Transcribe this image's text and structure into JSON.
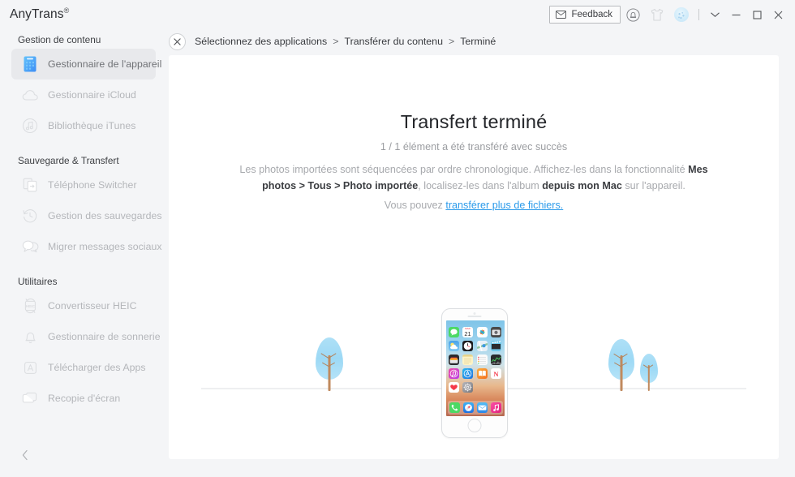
{
  "app": {
    "brand": "AnyTrans",
    "brand_mark": "®"
  },
  "titlebar": {
    "feedback_label": "Feedback",
    "feedback_icon": "envelope-icon",
    "notification_icon": "bell-icon",
    "skin_icon": "tshirt-icon",
    "avatar_icon": "user-avatar",
    "dropdown_icon": "chevron-down-icon",
    "minimize_icon": "minimize-icon",
    "maximize_icon": "maximize-icon",
    "close_icon": "close-icon"
  },
  "sidebar": {
    "sections": [
      {
        "title": "Gestion de contenu",
        "items": [
          {
            "label": "Gestionnaire de l'appareil",
            "icon": "device-icon",
            "active": true
          },
          {
            "label": "Gestionnaire iCloud",
            "icon": "cloud-icon",
            "active": false
          },
          {
            "label": "Bibliothèque iTunes",
            "icon": "itunes-note-icon",
            "active": false
          }
        ]
      },
      {
        "title": "Sauvegarde & Transfert",
        "items": [
          {
            "label": "Téléphone Switcher",
            "icon": "phone-switcher-icon",
            "active": false
          },
          {
            "label": "Gestion des sauvegardes",
            "icon": "backup-clock-icon",
            "active": false
          },
          {
            "label": "Migrer messages sociaux",
            "icon": "chat-bubbles-icon",
            "active": false
          }
        ]
      },
      {
        "title": "Utilitaires",
        "items": [
          {
            "label": "Convertisseur HEIC",
            "icon": "heic-convert-icon",
            "active": false
          },
          {
            "label": "Gestionnaire de sonnerie",
            "icon": "bell-ringtone-icon",
            "active": false
          },
          {
            "label": "Télécharger des Apps",
            "icon": "app-store-icon",
            "active": false
          },
          {
            "label": "Recopie d'écran",
            "icon": "screen-mirror-icon",
            "active": false
          }
        ]
      }
    ],
    "collapse_icon": "chevron-left-icon"
  },
  "breadcrumb": {
    "close_icon": "close-icon",
    "separator": ">",
    "crumbs": [
      "Sélectionnez des applications",
      "Transférer du contenu",
      "Terminé"
    ]
  },
  "main": {
    "title": "Transfert terminé",
    "subtitle": "1 / 1 élément a été transféré avec succès",
    "description": {
      "part1": "Les photos importées sont séquencées par ordre chronologique. Affichez-les dans la fonctionnalité ",
      "bold1": "Mes photos > Tous > Photo importée",
      "part2": ", localisez-les dans l'album ",
      "bold2": "depuis mon Mac",
      "part3": " sur l'appareil."
    },
    "more": {
      "prefix": "Vous pouvez ",
      "link": "transférer plus de fichiers."
    },
    "illustration": {
      "device_icon": "iphone-illustration",
      "tree_left_icon": "tree-icon",
      "tree_right_large_icon": "tree-icon",
      "tree_right_small_icon": "tree-icon",
      "ground_icon": "ground-line"
    }
  },
  "phone_screen": {
    "apps": [
      {
        "name": "Messages",
        "color": "#4cd964",
        "label": "Messages"
      },
      {
        "name": "Calendar",
        "color": "#ffffff",
        "label": "Calendrier"
      },
      {
        "name": "Photos",
        "color": "#fefefe",
        "label": "Photos"
      },
      {
        "name": "Camera",
        "color": "#4a4a4a",
        "label": "Appareil"
      },
      {
        "name": "Weather",
        "color": "#4aa3e8",
        "label": "Météo"
      },
      {
        "name": "Clock",
        "color": "#1c1c1e",
        "label": "Horloge"
      },
      {
        "name": "Maps",
        "color": "#3b9ae1",
        "label": "Plans"
      },
      {
        "name": "Videos",
        "color": "#6fc8ea",
        "label": "Vidéos"
      },
      {
        "name": "Wallet",
        "color": "#2b2b2d",
        "label": "Wallet"
      },
      {
        "name": "Notes",
        "color": "#fdf3c4",
        "label": "Notes"
      },
      {
        "name": "Reminders",
        "color": "#fbfbfb",
        "label": "Rappels"
      },
      {
        "name": "Stocks",
        "color": "#2a2a2c",
        "label": "Bourse"
      },
      {
        "name": "iTunes",
        "color": "#ef34b5",
        "label": "iTunes Store"
      },
      {
        "name": "AppStore",
        "color": "#2b9ae8",
        "label": "App Store"
      },
      {
        "name": "iBooks",
        "color": "#f98a20",
        "label": "iBooks"
      },
      {
        "name": "News",
        "color": "#f5394a",
        "label": "News"
      },
      {
        "name": "Health",
        "color": "#ffffff",
        "label": "Santé"
      },
      {
        "name": "Settings",
        "color": "#8e8e93",
        "label": "Réglages"
      }
    ],
    "dock": [
      {
        "name": "Phone",
        "color": "#4cd964"
      },
      {
        "name": "Safari",
        "color": "#2b8ee8"
      },
      {
        "name": "Mail",
        "color": "#3aa8f0"
      },
      {
        "name": "Music",
        "color": "#f0348f"
      }
    ]
  },
  "colors": {
    "accent_link": "#2c9bea",
    "device_icon_blue": "#4aa8f5",
    "tree_leaf": "#a9defa",
    "tree_trunk": "#c08a5e",
    "panel_bg": "#ffffff",
    "window_bg": "#f4f5f7",
    "active_item_bg": "#e8e9ec"
  }
}
